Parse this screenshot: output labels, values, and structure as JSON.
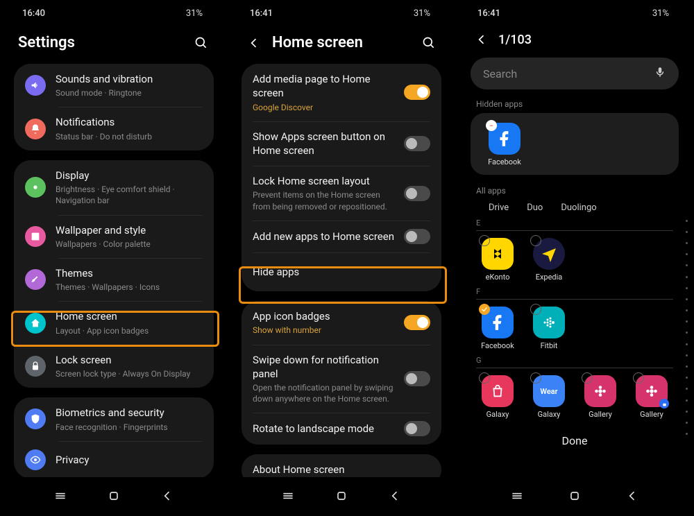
{
  "status": {
    "time1": "16:40",
    "time2": "16:41",
    "time3": "16:41",
    "battery": "31%"
  },
  "phone1": {
    "title": "Settings",
    "items": {
      "sounds": {
        "title": "Sounds and vibration",
        "sub": "Sound mode · Ringtone"
      },
      "notifications": {
        "title": "Notifications",
        "sub": "Status bar · Do not disturb"
      },
      "display": {
        "title": "Display",
        "sub": "Brightness · Eye comfort shield · Navigation bar"
      },
      "wallpaper": {
        "title": "Wallpaper and style",
        "sub": "Wallpapers · Color palette"
      },
      "themes": {
        "title": "Themes",
        "sub": "Themes · Wallpapers · Icons"
      },
      "home": {
        "title": "Home screen",
        "sub": "Layout · App icon badges"
      },
      "lock": {
        "title": "Lock screen",
        "sub": "Screen lock type · Always On Display"
      },
      "biometrics": {
        "title": "Biometrics and security",
        "sub": "Face recognition · Fingerprints"
      },
      "privacy": {
        "title": "Privacy",
        "sub": ""
      }
    }
  },
  "phone2": {
    "title": "Home screen",
    "items": {
      "media": {
        "title": "Add media page to Home screen",
        "sub": "Google Discover"
      },
      "appsbtn": {
        "title": "Show Apps screen button on Home screen"
      },
      "locklayout": {
        "title": "Lock Home screen layout",
        "sub": "Prevent items on the Home screen from being removed or repositioned."
      },
      "addnew": {
        "title": "Add new apps to Home screen"
      },
      "hide": {
        "title": "Hide apps"
      },
      "badges": {
        "title": "App icon badges",
        "sub": "Show with number"
      },
      "swipe": {
        "title": "Swipe down for notification panel",
        "sub": "Open the notification panel by swiping down anywhere on the Home screen."
      },
      "rotate": {
        "title": "Rotate to landscape mode"
      },
      "about": {
        "title": "About Home screen"
      }
    }
  },
  "phone3": {
    "counter": "1/103",
    "search_placeholder": "Search",
    "hidden_label": "Hidden apps",
    "hidden_apps": {
      "facebook": "Facebook"
    },
    "all_label": "All apps",
    "tabs": {
      "drive": "Drive",
      "duo": "Duo",
      "duolingo": "Duolingo"
    },
    "letters": {
      "e": "E",
      "f": "F",
      "g": "G"
    },
    "apps": {
      "ekonto": "eKonto",
      "expedia": "Expedia",
      "facebook": "Facebook",
      "fitbit": "Fitbit",
      "galaxy1": "Galaxy",
      "galaxy2": "Galaxy",
      "gallery1": "Gallery",
      "gallery2": "Gallery"
    },
    "done": "Done"
  }
}
